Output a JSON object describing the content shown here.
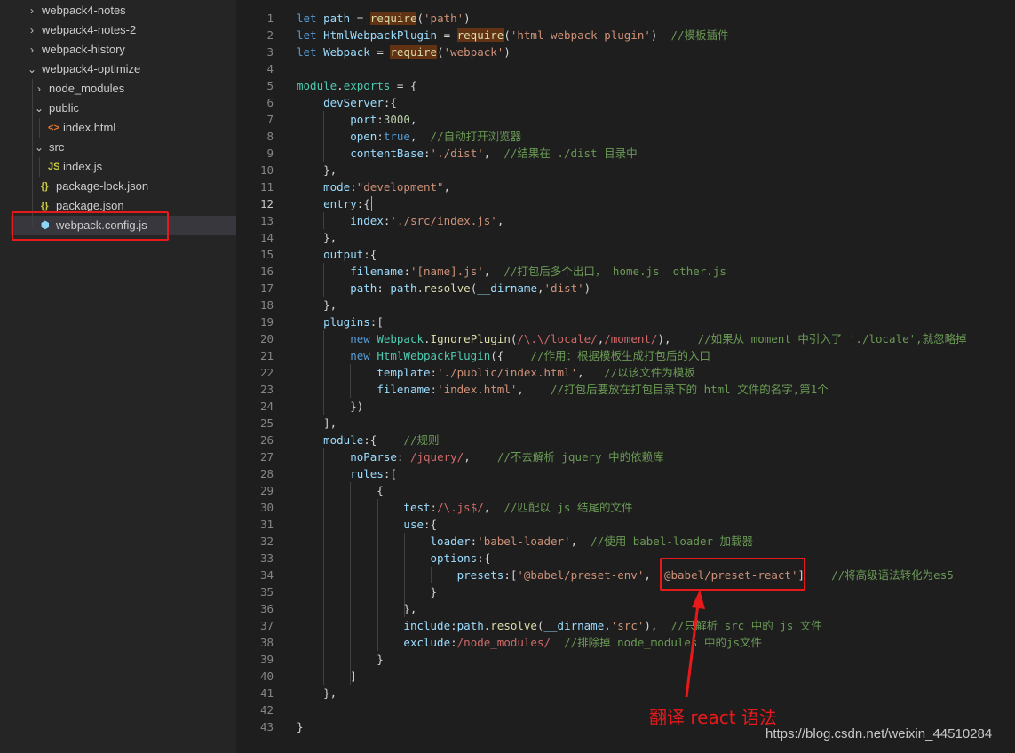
{
  "explorer": {
    "items": [
      {
        "label": "webpack4-notes",
        "chevron": "›",
        "icon": "",
        "icon_color": "",
        "depth": 0,
        "folder": true
      },
      {
        "label": "webpack4-notes-2",
        "chevron": "›",
        "icon": "",
        "icon_color": "",
        "depth": 0,
        "folder": true
      },
      {
        "label": "webpack-history",
        "chevron": "›",
        "icon": "",
        "icon_color": "",
        "depth": 0,
        "folder": true
      },
      {
        "label": "webpack4-optimize",
        "chevron": "⌄",
        "icon": "",
        "icon_color": "",
        "depth": 0,
        "folder": true
      },
      {
        "label": "node_modules",
        "chevron": "›",
        "icon": "",
        "icon_color": "",
        "depth": 1,
        "folder": true
      },
      {
        "label": "public",
        "chevron": "⌄",
        "icon": "",
        "icon_color": "",
        "depth": 1,
        "folder": true
      },
      {
        "label": "index.html",
        "chevron": "",
        "icon": "<>",
        "icon_color": "#e37933",
        "depth": 2,
        "folder": false
      },
      {
        "label": "src",
        "chevron": "⌄",
        "icon": "",
        "icon_color": "",
        "depth": 1,
        "folder": true
      },
      {
        "label": "index.js",
        "chevron": "",
        "icon": "JS",
        "icon_color": "#cbcb41",
        "depth": 2,
        "folder": false
      },
      {
        "label": "package-lock.json",
        "chevron": "",
        "icon": "{}",
        "icon_color": "#cbcb41",
        "depth": 1,
        "folder": false
      },
      {
        "label": "package.json",
        "chevron": "",
        "icon": "{}",
        "icon_color": "#cbcb41",
        "depth": 1,
        "folder": false
      },
      {
        "label": "webpack.config.js",
        "chevron": "",
        "icon": "⬢",
        "icon_color": "#8dd6f9",
        "depth": 1,
        "folder": false,
        "selected": true
      }
    ]
  },
  "editor": {
    "active_line": 12,
    "lines": [
      [
        [
          "k",
          "let "
        ],
        [
          "v",
          "path"
        ],
        [
          "d",
          " = "
        ],
        [
          "hl",
          "require"
        ],
        [
          "d",
          "("
        ],
        [
          "s",
          "'path'"
        ],
        [
          "d",
          ")"
        ]
      ],
      [
        [
          "k",
          "let "
        ],
        [
          "v",
          "HtmlWebpackPlugin"
        ],
        [
          "d",
          " = "
        ],
        [
          "hl",
          "require"
        ],
        [
          "d",
          "("
        ],
        [
          "s",
          "'html-webpack-plugin'"
        ],
        [
          "d",
          ")  "
        ],
        [
          "c",
          "//模板插件"
        ]
      ],
      [
        [
          "k",
          "let "
        ],
        [
          "v",
          "Webpack"
        ],
        [
          "d",
          " = "
        ],
        [
          "hl",
          "require"
        ],
        [
          "d",
          "("
        ],
        [
          "s",
          "'webpack'"
        ],
        [
          "d",
          ")"
        ]
      ],
      [],
      [
        [
          "t",
          "module"
        ],
        [
          "d",
          "."
        ],
        [
          "t",
          "exports"
        ],
        [
          "d",
          " = {"
        ]
      ],
      [
        [
          "d",
          "    "
        ],
        [
          "v",
          "devServer"
        ],
        [
          "d",
          ":{"
        ]
      ],
      [
        [
          "d",
          "        "
        ],
        [
          "v",
          "port"
        ],
        [
          "d",
          ":"
        ],
        [
          "n",
          "3000"
        ],
        [
          "d",
          ","
        ]
      ],
      [
        [
          "d",
          "        "
        ],
        [
          "v",
          "open"
        ],
        [
          "d",
          ":"
        ],
        [
          "k",
          "true"
        ],
        [
          "d",
          ",  "
        ],
        [
          "c",
          "//自动打开浏览器"
        ]
      ],
      [
        [
          "d",
          "        "
        ],
        [
          "v",
          "contentBase"
        ],
        [
          "d",
          ":"
        ],
        [
          "s",
          "'./dist'"
        ],
        [
          "d",
          ",  "
        ],
        [
          "c",
          "//结果在 ./dist 目录中"
        ]
      ],
      [
        [
          "d",
          "    },"
        ]
      ],
      [
        [
          "d",
          "    "
        ],
        [
          "v",
          "mode"
        ],
        [
          "d",
          ":"
        ],
        [
          "s",
          "\"development\""
        ],
        [
          "d",
          ","
        ]
      ],
      [
        [
          "d",
          "    "
        ],
        [
          "v",
          "entry"
        ],
        [
          "d",
          ":{"
        ]
      ],
      [
        [
          "d",
          "        "
        ],
        [
          "v",
          "index"
        ],
        [
          "d",
          ":"
        ],
        [
          "s",
          "'./src/index.js'"
        ],
        [
          "d",
          ","
        ]
      ],
      [
        [
          "d",
          "    },"
        ]
      ],
      [
        [
          "d",
          "    "
        ],
        [
          "v",
          "output"
        ],
        [
          "d",
          ":{"
        ]
      ],
      [
        [
          "d",
          "        "
        ],
        [
          "v",
          "filename"
        ],
        [
          "d",
          ":"
        ],
        [
          "s",
          "'[name].js'"
        ],
        [
          "d",
          ",  "
        ],
        [
          "c",
          "//打包后多个出口， home.js  other.js"
        ]
      ],
      [
        [
          "d",
          "        "
        ],
        [
          "v",
          "path"
        ],
        [
          "d",
          ": "
        ],
        [
          "v",
          "path"
        ],
        [
          "d",
          "."
        ],
        [
          "f",
          "resolve"
        ],
        [
          "d",
          "("
        ],
        [
          "v",
          "__dirname"
        ],
        [
          "d",
          ","
        ],
        [
          "s",
          "'dist'"
        ],
        [
          "d",
          ")"
        ]
      ],
      [
        [
          "d",
          "    },"
        ]
      ],
      [
        [
          "d",
          "    "
        ],
        [
          "v",
          "plugins"
        ],
        [
          "d",
          ":["
        ]
      ],
      [
        [
          "d",
          "        "
        ],
        [
          "k",
          "new "
        ],
        [
          "t",
          "Webpack"
        ],
        [
          "d",
          "."
        ],
        [
          "f",
          "IgnorePlugin"
        ],
        [
          "d",
          "("
        ],
        [
          "r",
          "/\\.\\/locale/"
        ],
        [
          "d",
          ","
        ],
        [
          "r",
          "/moment/"
        ],
        [
          "d",
          "),    "
        ],
        [
          "c",
          "//如果从 moment 中引入了 './locale',就忽略掉"
        ]
      ],
      [
        [
          "d",
          "        "
        ],
        [
          "k",
          "new "
        ],
        [
          "t",
          "HtmlWebpackPlugin"
        ],
        [
          "d",
          "({    "
        ],
        [
          "c",
          "//作用：根据模板生成打包后的入口"
        ]
      ],
      [
        [
          "d",
          "            "
        ],
        [
          "v",
          "template"
        ],
        [
          "d",
          ":"
        ],
        [
          "s",
          "'./public/index.html'"
        ],
        [
          "d",
          ",   "
        ],
        [
          "c",
          "//以该文件为模板"
        ]
      ],
      [
        [
          "d",
          "            "
        ],
        [
          "v",
          "filename"
        ],
        [
          "d",
          ":"
        ],
        [
          "s",
          "'index.html'"
        ],
        [
          "d",
          ",    "
        ],
        [
          "c",
          "//打包后要放在打包目录下的 html 文件的名字,第1个"
        ]
      ],
      [
        [
          "d",
          "        })"
        ]
      ],
      [
        [
          "d",
          "    ],"
        ]
      ],
      [
        [
          "d",
          "    "
        ],
        [
          "v",
          "module"
        ],
        [
          "d",
          ":{    "
        ],
        [
          "c",
          "//规则"
        ]
      ],
      [
        [
          "d",
          "        "
        ],
        [
          "v",
          "noParse"
        ],
        [
          "d",
          ": "
        ],
        [
          "r",
          "/jquery/"
        ],
        [
          "d",
          ",    "
        ],
        [
          "c",
          "//不去解析 jquery 中的依赖库"
        ]
      ],
      [
        [
          "d",
          "        "
        ],
        [
          "v",
          "rules"
        ],
        [
          "d",
          ":["
        ]
      ],
      [
        [
          "d",
          "            {"
        ]
      ],
      [
        [
          "d",
          "                "
        ],
        [
          "v",
          "test"
        ],
        [
          "d",
          ":"
        ],
        [
          "r",
          "/\\.js$/"
        ],
        [
          "d",
          ",  "
        ],
        [
          "c",
          "//匹配以 js 结尾的文件"
        ]
      ],
      [
        [
          "d",
          "                "
        ],
        [
          "v",
          "use"
        ],
        [
          "d",
          ":{"
        ]
      ],
      [
        [
          "d",
          "                    "
        ],
        [
          "v",
          "loader"
        ],
        [
          "d",
          ":"
        ],
        [
          "s",
          "'babel-loader'"
        ],
        [
          "d",
          ",  "
        ],
        [
          "c",
          "//使用 babel-loader 加载器"
        ]
      ],
      [
        [
          "d",
          "                    "
        ],
        [
          "v",
          "options"
        ],
        [
          "d",
          ":{"
        ]
      ],
      [
        [
          "d",
          "                        "
        ],
        [
          "v",
          "presets"
        ],
        [
          "d",
          ":["
        ],
        [
          "s",
          "'@babel/preset-env'"
        ],
        [
          "d",
          ", "
        ],
        [
          "s",
          "'@babel/preset-react'"
        ],
        [
          "d",
          "]    "
        ],
        [
          "c",
          "//将高级语法转化为es5"
        ]
      ],
      [
        [
          "d",
          "                    }"
        ]
      ],
      [
        [
          "d",
          "                },"
        ]
      ],
      [
        [
          "d",
          "                "
        ],
        [
          "v",
          "include"
        ],
        [
          "d",
          ":"
        ],
        [
          "v",
          "path"
        ],
        [
          "d",
          "."
        ],
        [
          "f",
          "resolve"
        ],
        [
          "d",
          "("
        ],
        [
          "v",
          "__dirname"
        ],
        [
          "d",
          ","
        ],
        [
          "s",
          "'src'"
        ],
        [
          "d",
          "),  "
        ],
        [
          "c",
          "//只解析 src 中的 js 文件"
        ]
      ],
      [
        [
          "d",
          "                "
        ],
        [
          "v",
          "exclude"
        ],
        [
          "d",
          ":"
        ],
        [
          "r",
          "/node_modules/"
        ],
        [
          "d",
          "  "
        ],
        [
          "c",
          "//排除掉 node_modules 中的js文件"
        ]
      ],
      [
        [
          "d",
          "            }"
        ]
      ],
      [
        [
          "d",
          "        ]"
        ]
      ],
      [
        [
          "d",
          "    },"
        ]
      ],
      [],
      [
        [
          "d",
          "}"
        ]
      ]
    ]
  },
  "annotation": {
    "text": "翻译 react 语法"
  },
  "watermark": {
    "text": "https://blog.csdn.net/weixin_44510284"
  },
  "colors": {
    "annotation_red": "#e8191a",
    "selection": "#37373d",
    "background": "#1e1e1e"
  }
}
